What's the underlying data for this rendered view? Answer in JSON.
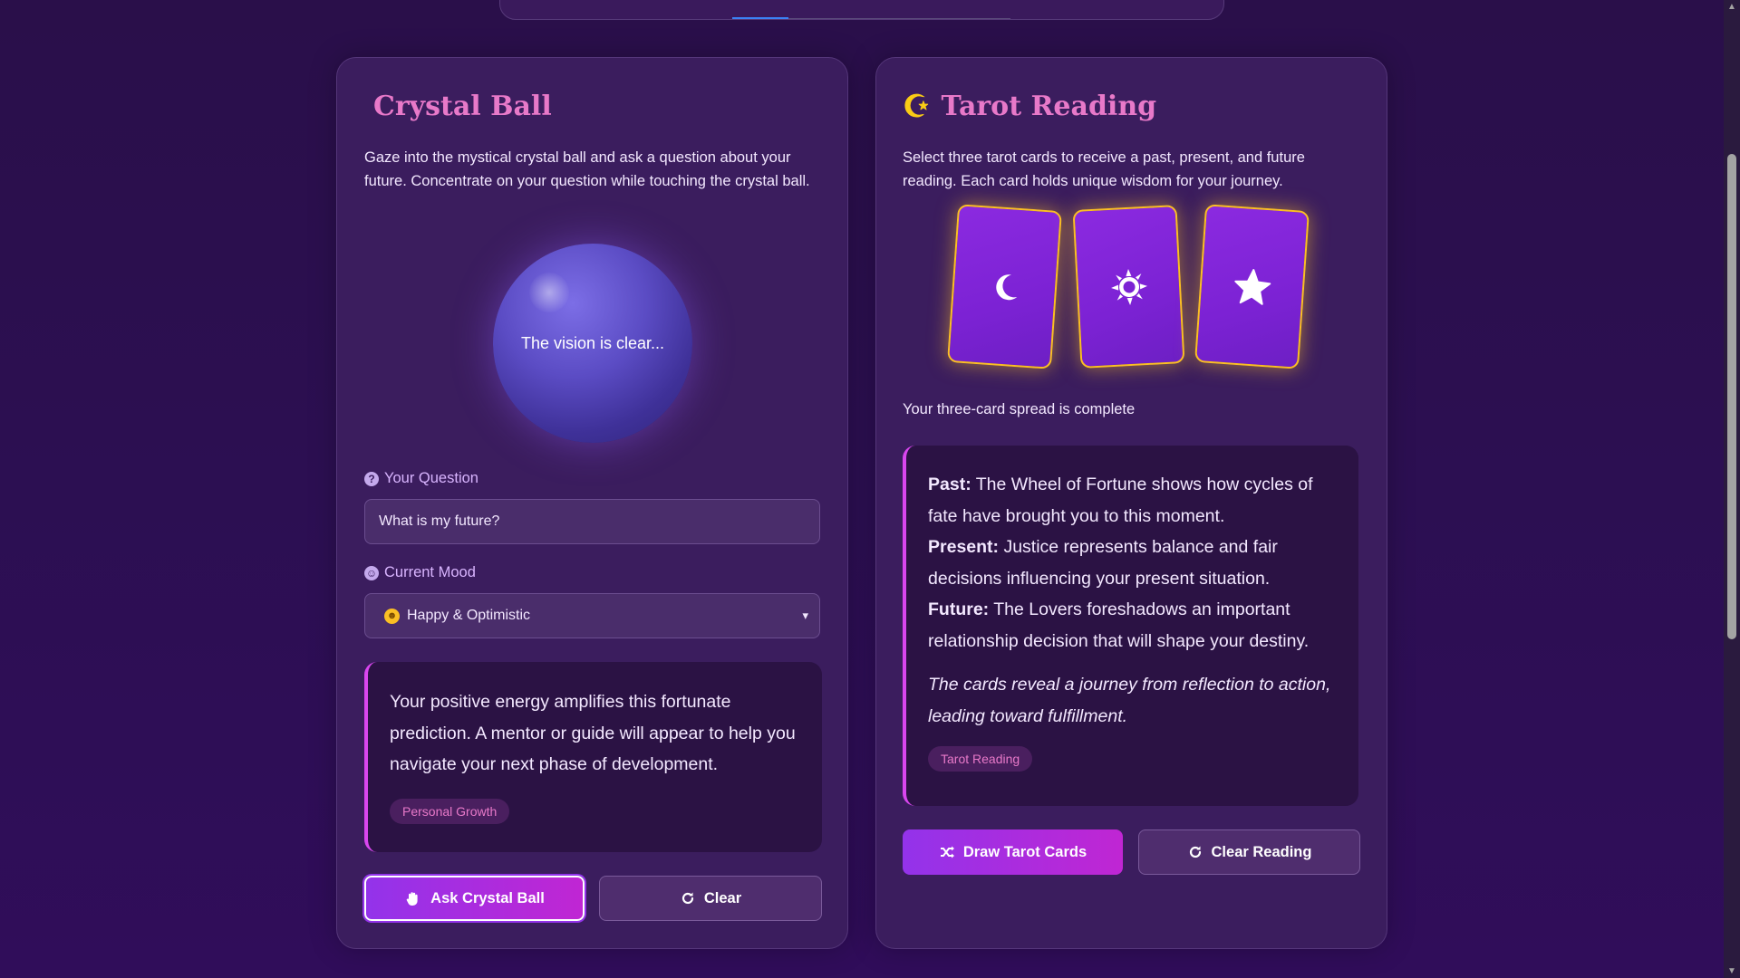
{
  "crystal_ball": {
    "title": "Crystal Ball",
    "description": "Gaze into the mystical crystal ball and ask a question about your future. Concentrate on your question while touching the crystal ball.",
    "ball_text": "The vision is clear...",
    "question_label": "Your Question",
    "question_value": "What is my future?",
    "mood_label": "Current Mood",
    "mood_value": "Happy & Optimistic",
    "prediction": "Your positive energy amplifies this fortunate prediction. A mentor or guide will appear to help you navigate your next phase of development.",
    "tag": "Personal Growth",
    "ask_button": "Ask Crystal Ball",
    "clear_button": "Clear"
  },
  "tarot": {
    "title": "Tarot Reading",
    "description": "Select three tarot cards to receive a past, present, and future reading. Each card holds unique wisdom for your journey.",
    "cards": [
      {
        "icon": "moon-icon"
      },
      {
        "icon": "sun-icon"
      },
      {
        "icon": "star-icon"
      }
    ],
    "status": "Your three-card spread is complete",
    "past_label": "Past:",
    "past_text": "The Wheel of Fortune shows how cycles of fate have brought you to this moment.",
    "present_label": "Present:",
    "present_text": "Justice represents balance and fair decisions influencing your present situation.",
    "future_label": "Future:",
    "future_text": "The Lovers foreshadows an important relationship decision that will shape your destiny.",
    "summary": "The cards reveal a journey from reflection to action, leading toward fulfillment.",
    "tag": "Tarot Reading",
    "draw_button": "Draw Tarot Cards",
    "clear_button": "Clear Reading"
  },
  "colors": {
    "accent_pink": "#e879c9",
    "accent_purple": "#9333ea",
    "gold": "#fbbf24",
    "background": "#2a0f4a"
  }
}
